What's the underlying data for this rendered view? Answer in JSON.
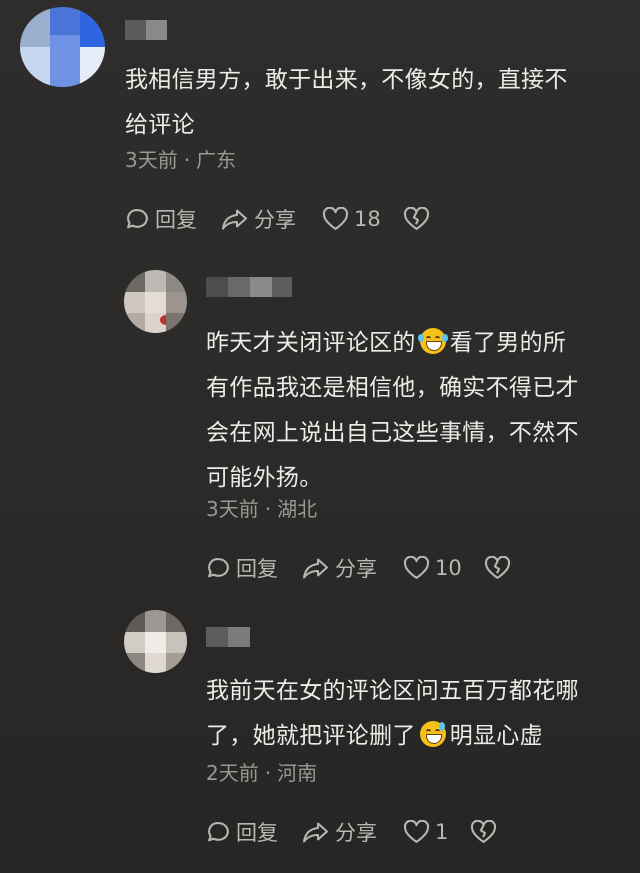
{
  "comments": [
    {
      "text_lines": [
        "我相信男方，敢于出来，不像女的，直接不",
        "给评论"
      ],
      "time": "3天前",
      "region": "广东",
      "reply_label": "回复",
      "share_label": "分享",
      "like_count": "18"
    },
    {
      "text_line1_before": "昨天才关闭评论区的",
      "text_line1_after": "看了男的所",
      "text_lines": [
        "有作品我还是相信他，确实不得已才",
        "会在网上说出自己这些事情，不然不",
        "可能外扬。"
      ],
      "time": "3天前",
      "region": "湖北",
      "reply_label": "回复",
      "share_label": "分享",
      "like_count": "10"
    },
    {
      "text_line1": "我前天在女的评论区问五百万都花哪",
      "text_line2_before": "了，她就把评论删了",
      "text_line2_after": "明显心虚",
      "time": "2天前",
      "region": "河南",
      "reply_label": "回复",
      "share_label": "分享",
      "like_count": "1"
    }
  ],
  "icons": {
    "reply": "reply-bubble-icon",
    "share": "share-arrow-icon",
    "like": "heart-outline-icon",
    "dislike": "broken-heart-icon"
  },
  "colors": {
    "background": "#2c2b29",
    "text": "#ecebe8",
    "meta": "#9a9894",
    "action": "#b9b7b3"
  }
}
